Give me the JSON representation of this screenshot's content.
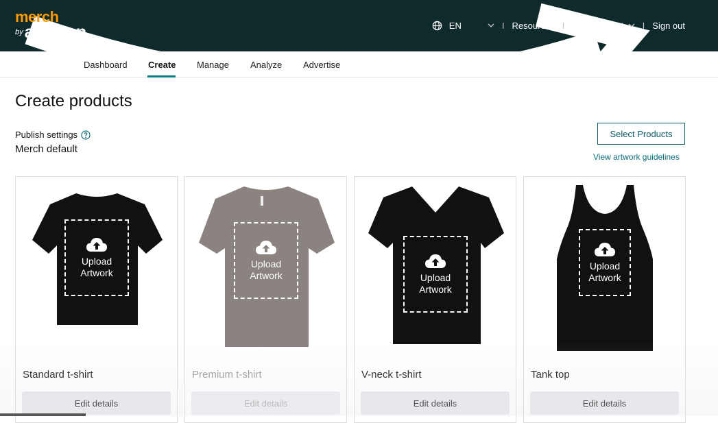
{
  "header": {
    "logo_merch": "merch",
    "logo_by": "by",
    "logo_amazon": "amazon",
    "language": "EN",
    "separator": "I",
    "resources": "Resources",
    "account": "Your account",
    "sign_out": "Sign out"
  },
  "subnav": {
    "tabs": [
      {
        "label": "Dashboard"
      },
      {
        "label": "Create",
        "active": true
      },
      {
        "label": "Manage"
      },
      {
        "label": "Analyze"
      },
      {
        "label": "Advertise"
      }
    ]
  },
  "main": {
    "title": "Create products",
    "publish_label": "Publish settings",
    "publish_value": "Merch default",
    "select_products": "Select Products",
    "artwork_guidelines": "View artwork guidelines"
  },
  "products": [
    {
      "name": "Standard t-shirt",
      "upload_line1": "Upload",
      "upload_line2": "Artwork",
      "edit_label": "Edit details",
      "shirt_color": "#111111",
      "enabled": true
    },
    {
      "name": "Premium t-shirt",
      "upload_line1": "Upload",
      "upload_line2": "Artwork",
      "edit_label": "Edit details",
      "shirt_color": "#8a8380",
      "enabled": false
    },
    {
      "name": "V-neck t-shirt",
      "upload_line1": "Upload",
      "upload_line2": "Artwork",
      "edit_label": "Edit details",
      "shirt_color": "#111111",
      "enabled": true
    },
    {
      "name": "Tank top",
      "upload_line1": "Upload",
      "upload_line2": "Artwork",
      "edit_label": "Edit details",
      "shirt_color": "#111111",
      "enabled": true
    }
  ],
  "colors": {
    "header_bg": "#0f2a2a",
    "brand_orange": "#ff9900",
    "accent_teal": "#0a7d89"
  },
  "icons": {
    "globe": "globe-icon",
    "help": "help-circle-icon",
    "upload": "cloud-upload-icon",
    "chevron": "chevron-down-icon"
  }
}
